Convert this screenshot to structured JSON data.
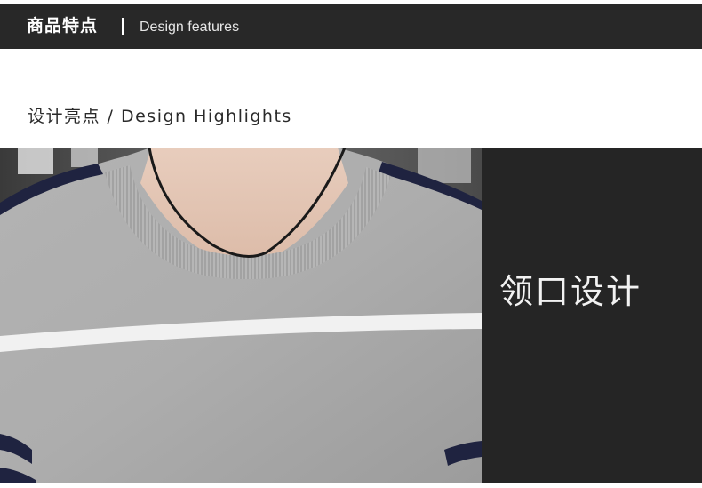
{
  "header": {
    "title_cn": "商品特点",
    "separator": "|",
    "title_en": "Design features"
  },
  "section": {
    "heading": "设计亮点 / Design Highlights"
  },
  "feature": {
    "title": "领口设计"
  },
  "colors": {
    "header_bg": "#282828",
    "panel_bg": "#252525",
    "sweater_gray": "#a9a9a9",
    "stripe_white": "#f1f1f1",
    "stripe_navy": "#1f2340"
  }
}
